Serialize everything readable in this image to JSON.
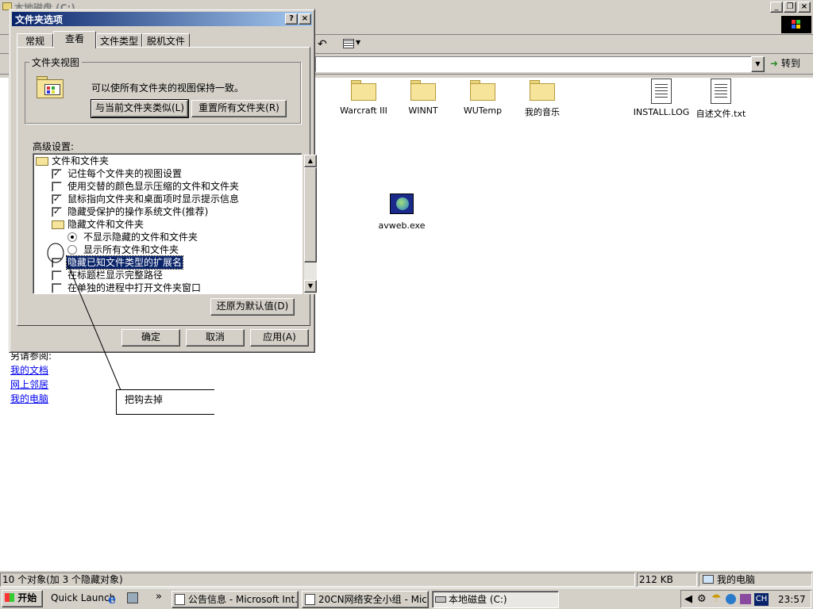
{
  "explorer": {
    "title": "本地磁盘 (C:)",
    "win_buttons": [
      "_",
      "❐",
      "×"
    ],
    "address_dropdown": "▼",
    "go_label": "转到",
    "content_left_heading": "另请参阅:",
    "links": [
      "我的文档",
      "网上邻居",
      "我的电脑"
    ],
    "files": [
      {
        "name": "Warcraft III",
        "type": "folder"
      },
      {
        "name": "WINNT",
        "type": "folder"
      },
      {
        "name": "WUTemp",
        "type": "folder"
      },
      {
        "name": "我的音乐",
        "type": "folder"
      },
      {
        "name": "INSTALL.LOG",
        "type": "document"
      },
      {
        "name": "自述文件.txt",
        "type": "document"
      },
      {
        "name": "avweb.exe",
        "type": "exe"
      }
    ]
  },
  "status": {
    "left": "10 个对象(加 3 个隐藏对象)",
    "size": "212 KB",
    "location": "我的电脑"
  },
  "taskbar": {
    "start_label": "开始",
    "quick_launch": "Quick Launch",
    "chevron": "»",
    "tasks": [
      "公告信息 - Microsoft Int...",
      "20CN网络安全小组 - Mic...",
      "本地磁盘 (C:)"
    ],
    "tray_lang": "CH",
    "clock": "23:57"
  },
  "dialog": {
    "title": "文件夹选项",
    "help_button": "?",
    "close_button": "×",
    "tabs": [
      "常规",
      "查看",
      "文件类型",
      "脱机文件"
    ],
    "active_tab": "查看",
    "folder_view_group": "文件夹视图",
    "folder_view_text": "可以使所有文件夹的视图保持一致。",
    "like_current_button": "与当前文件夹类似(L)",
    "reset_all_button": "重置所有文件夹(R)",
    "advanced_label": "高级设置:",
    "settings": [
      {
        "type": "folder",
        "label": "文件和文件夹",
        "indent": 0
      },
      {
        "type": "check",
        "label": "记住每个文件夹的视图设置",
        "checked": true,
        "indent": 1
      },
      {
        "type": "check",
        "label": "使用交替的颜色显示压缩的文件和文件夹",
        "checked": false,
        "indent": 1
      },
      {
        "type": "check",
        "label": "鼠标指向文件夹和桌面项时显示提示信息",
        "checked": true,
        "indent": 1
      },
      {
        "type": "check",
        "label": "隐藏受保护的操作系统文件(推荐)",
        "checked": true,
        "indent": 1
      },
      {
        "type": "folder",
        "label": "隐藏文件和文件夹",
        "indent": 1
      },
      {
        "type": "radio",
        "label": "不显示隐藏的文件和文件夹",
        "checked": true,
        "indent": 2
      },
      {
        "type": "radio",
        "label": "显示所有文件和文件夹",
        "checked": false,
        "indent": 2
      },
      {
        "type": "check",
        "label": "隐藏已知文件类型的扩展名",
        "checked": false,
        "indent": 1,
        "selected": true
      },
      {
        "type": "check",
        "label": "在标题栏显示完整路径",
        "checked": false,
        "indent": 1
      },
      {
        "type": "check",
        "label": "在单独的进程中打开文件夹窗口",
        "checked": false,
        "indent": 1
      }
    ],
    "restore_defaults_button": "还原为默认值(D)",
    "ok_button": "确定",
    "cancel_button": "取消",
    "apply_button": "应用(A)"
  },
  "annotation": {
    "text": "把钩去掉"
  },
  "colors": {
    "face": "#d4d0c8",
    "title_active": "#0a246a",
    "selection": "#0a246a",
    "link": "#0000ee"
  }
}
